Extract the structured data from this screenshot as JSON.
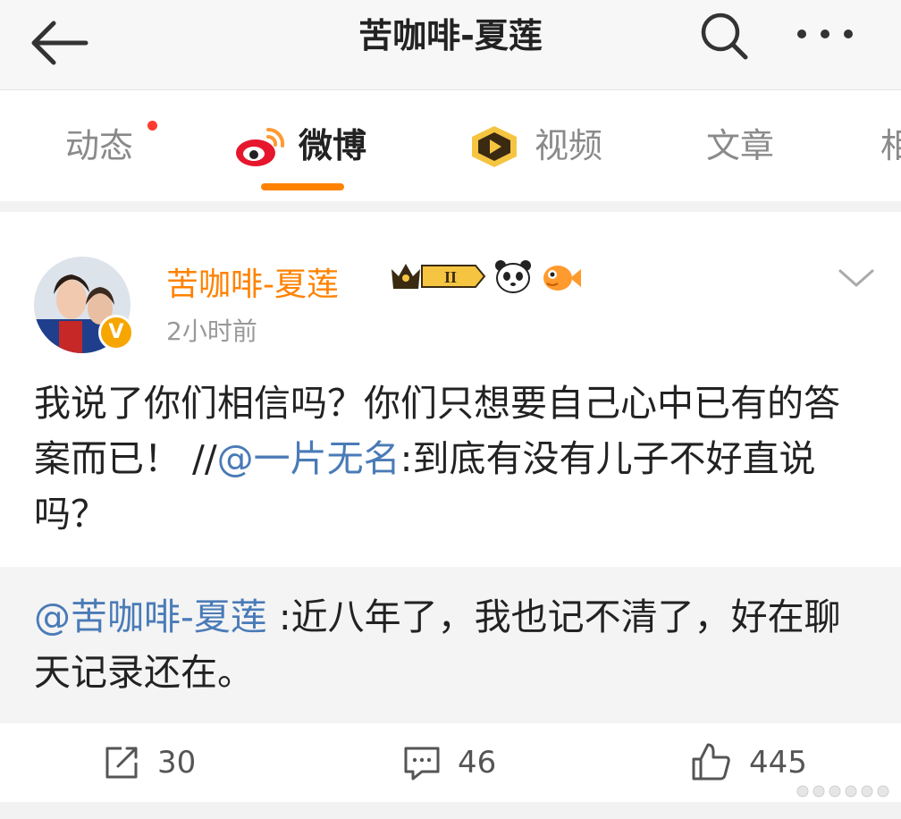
{
  "header": {
    "title": "苦咖啡-夏莲",
    "back_icon": "arrow-left-icon",
    "search_icon": "search-icon",
    "more_icon": "more-horizontal-icon"
  },
  "tabs": [
    {
      "label": "动态",
      "active": false,
      "has_dot": true
    },
    {
      "label": "微博",
      "active": true,
      "icon": "weibo-logo-icon"
    },
    {
      "label": "视频",
      "active": false,
      "icon": "video-play-icon"
    },
    {
      "label": "文章",
      "active": false
    },
    {
      "label": "相",
      "active": false
    }
  ],
  "post": {
    "username": "苦咖啡-夏莲",
    "level": "II",
    "time": "2小时前",
    "text_part1": "我说了你们相信吗？你们只想要自己心中已有的答案而已！ //",
    "mention1": "@一片无名",
    "text_part2": ":到底有没有儿子不好直说吗？",
    "repost_mention": "@苦咖啡-夏莲",
    "repost_text": " :近八年了，我也记不清了，好在聊天记录还在。"
  },
  "actions": {
    "repost_count": "30",
    "comment_count": "46",
    "like_count": "445"
  },
  "colors": {
    "accent": "#ff8200",
    "mention": "#4a7bb7",
    "dot": "#ff3b30"
  }
}
